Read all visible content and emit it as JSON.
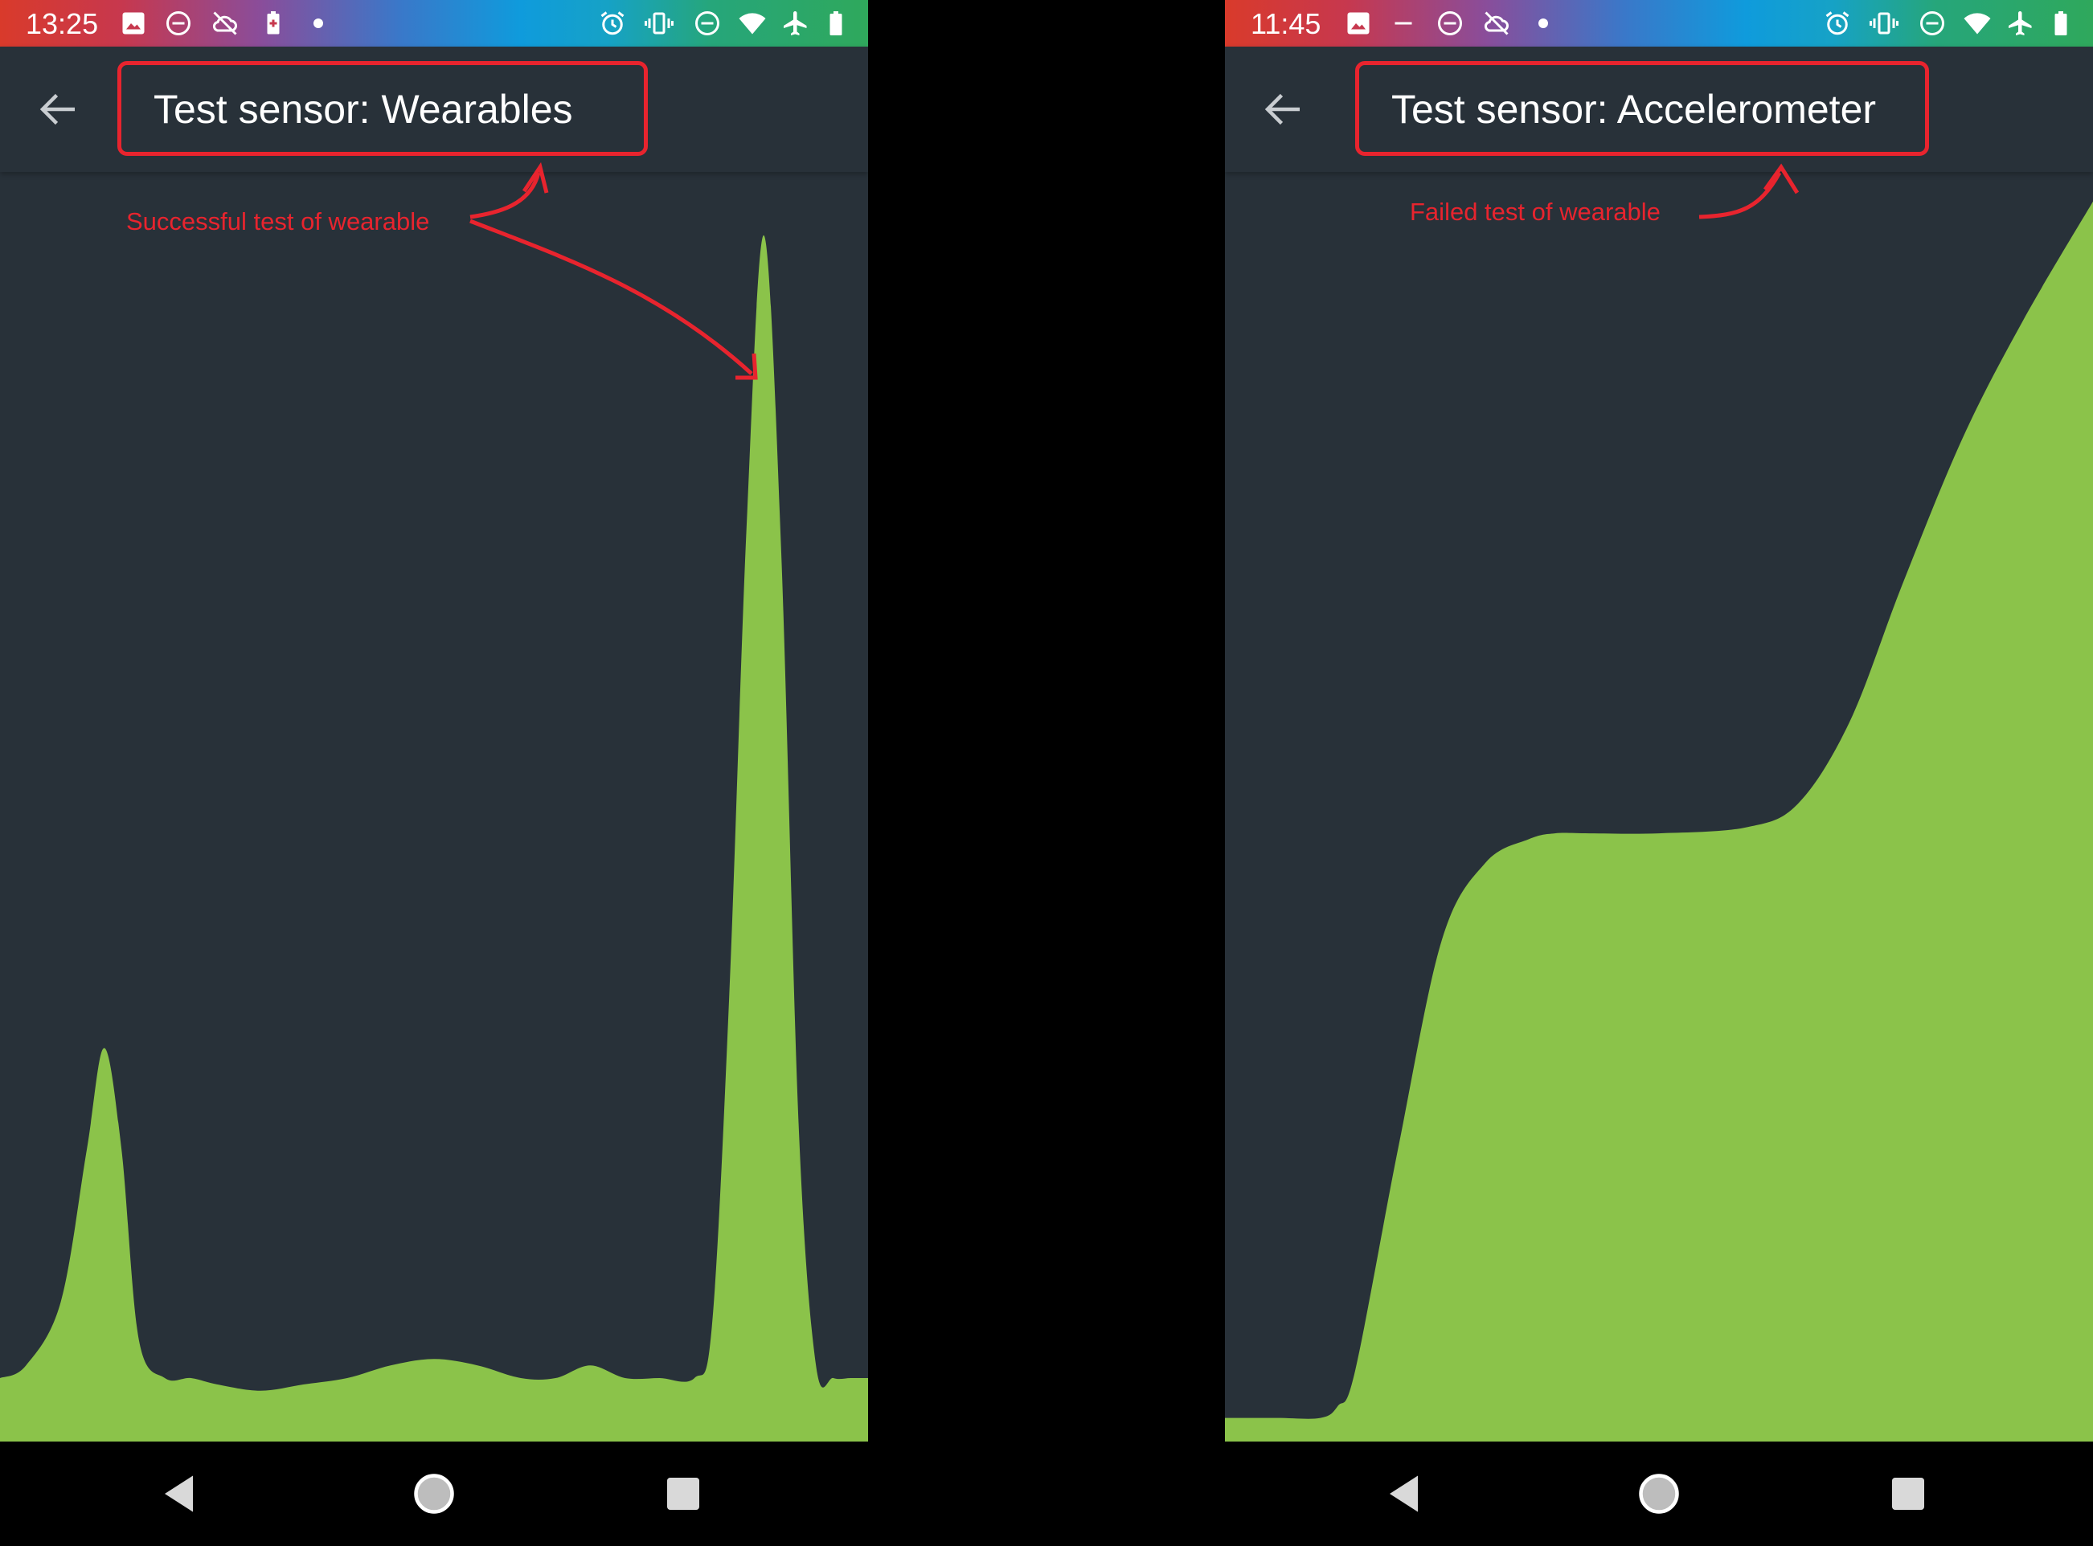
{
  "left_phone": {
    "status_bar": {
      "time": "13:25",
      "left_icons": [
        "image-icon",
        "do-not-disturb-icon",
        "cloud-off-icon",
        "battery-saver-icon",
        "dot-icon"
      ],
      "right_icons": [
        "alarm-icon",
        "vibrate-icon",
        "do-not-disturb-icon",
        "wifi-icon",
        "airplane-icon",
        "battery-icon"
      ]
    },
    "app_bar": {
      "back_icon": "arrow-back-icon",
      "title": "Test sensor: Wearables"
    },
    "annotation": "Successful test of wearable",
    "chart_data": {
      "type": "area",
      "title": "",
      "xlabel": "",
      "ylabel": "",
      "fill_color": "#8bc34a",
      "background_color": "#283139",
      "x": [
        0,
        0.03,
        0.07,
        0.1,
        0.12,
        0.14,
        0.16,
        0.19,
        0.22,
        0.25,
        0.3,
        0.35,
        0.4,
        0.45,
        0.5,
        0.55,
        0.6,
        0.64,
        0.68,
        0.72,
        0.76,
        0.8,
        0.82,
        0.84,
        0.86,
        0.88,
        0.9,
        0.92,
        0.94,
        0.96,
        0.98,
        1.0
      ],
      "y": [
        0.05,
        0.06,
        0.11,
        0.23,
        0.31,
        0.23,
        0.08,
        0.05,
        0.05,
        0.045,
        0.04,
        0.045,
        0.05,
        0.06,
        0.065,
        0.06,
        0.05,
        0.05,
        0.06,
        0.05,
        0.05,
        0.05,
        0.09,
        0.35,
        0.72,
        0.95,
        0.7,
        0.25,
        0.06,
        0.05,
        0.05,
        0.05
      ]
    }
  },
  "right_phone": {
    "status_bar": {
      "time": "11:45",
      "left_icons": [
        "image-icon",
        "minus-icon",
        "do-not-disturb-icon",
        "cloud-off-icon",
        "dot-icon"
      ],
      "right_icons": [
        "alarm-icon",
        "vibrate-icon",
        "do-not-disturb-icon",
        "wifi-icon",
        "airplane-icon",
        "battery-icon"
      ]
    },
    "app_bar": {
      "back_icon": "arrow-back-icon",
      "title": "Test sensor: Accelerometer"
    },
    "annotation": "Failed test of wearable",
    "chart_data": {
      "type": "area",
      "title": "",
      "xlabel": "",
      "ylabel": "",
      "fill_color": "#8bc34a",
      "background_color": "#283139",
      "x": [
        0,
        0.06,
        0.11,
        0.13,
        0.15,
        0.2,
        0.25,
        0.3,
        0.35,
        0.38,
        0.42,
        0.5,
        0.6,
        0.66,
        0.72,
        0.78,
        0.85,
        0.92,
        1.0
      ],
      "y": [
        0.04,
        0.04,
        0.04,
        0.06,
        0.12,
        0.5,
        0.85,
        0.98,
        1.02,
        1.03,
        1.03,
        1.03,
        1.04,
        1.08,
        1.22,
        1.45,
        1.7,
        1.9,
        2.1
      ]
    }
  },
  "nav_bar": {
    "buttons": [
      "back-triangle-icon",
      "home-circle-icon",
      "recents-square-icon"
    ]
  }
}
